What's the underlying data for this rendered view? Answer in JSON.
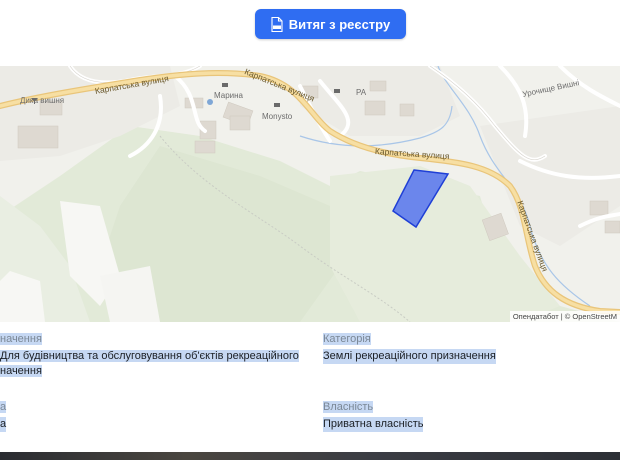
{
  "header": {
    "extract_button_label": "Витяг з реєстру",
    "extract_button_icon": "pdf-file-icon",
    "accent_color": "#2f6df2"
  },
  "map": {
    "labels": {
      "place_1": "Дика вишня",
      "place_2": "Марина",
      "place_3": "Monysto",
      "place_4": "РА",
      "place_5": "Урочище Вишні"
    },
    "roads": {
      "road_1": "Карпатська вулиця",
      "road_2": "Карпатська вулиця",
      "road_3": "Карпатська вулиця",
      "road_4": "Карпатська вулиця"
    },
    "attribution": "Опендатабот | © OpenStreetM",
    "parcel_color": "#4a6cf0"
  },
  "details": {
    "purpose_label": "начення",
    "purpose_value_line1": "Для будівництва та обслуговування об'єктів рекреаційного",
    "purpose_value_line2": "начення",
    "category_label": "Категорія",
    "category_value": "Землі рекреаційного призначення",
    "left2_label": "а",
    "left2_value": "а",
    "ownership_label": "Власність",
    "ownership_value": "Приватна власність"
  }
}
